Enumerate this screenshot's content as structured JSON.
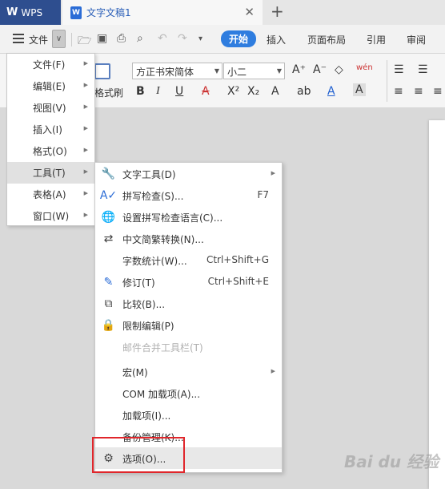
{
  "tabs": {
    "wps_label": "WPS",
    "doc_title": "文字文稿1",
    "close_symbol": "✕",
    "new_tab_symbol": "+"
  },
  "menubar": {
    "file_label": "文件",
    "ribbon_tabs": [
      "开始",
      "插入",
      "页面布局",
      "引用",
      "审阅"
    ],
    "active_tab_index": 0
  },
  "ribbon": {
    "paint_label": "格式刷",
    "font_name": "方正书宋简体",
    "font_size": "小二",
    "buttons_row1": [
      "A⁺",
      "A⁻",
      "◇",
      "wén"
    ],
    "buttons_row2": [
      "B",
      "I",
      "U",
      "A",
      "X²",
      "X₂",
      "A",
      "ab",
      "A",
      "A"
    ]
  },
  "main_menu": {
    "items": [
      {
        "label": "文件(F)"
      },
      {
        "label": "编辑(E)"
      },
      {
        "label": "视图(V)"
      },
      {
        "label": "插入(I)"
      },
      {
        "label": "格式(O)"
      },
      {
        "label": "工具(T)"
      },
      {
        "label": "表格(A)"
      },
      {
        "label": "窗口(W)"
      }
    ],
    "highlighted_index": 5
  },
  "tools_submenu": {
    "items": [
      {
        "label": "文字工具(D)",
        "shortcut": "",
        "icon": "wrench-icon",
        "has_submenu": true,
        "disabled": false
      },
      {
        "label": "拼写检查(S)...",
        "shortcut": "F7",
        "icon": "spellcheck-icon",
        "has_submenu": false,
        "disabled": false
      },
      {
        "label": "设置拼写检查语言(C)...",
        "shortcut": "",
        "icon": "globe-language-icon",
        "has_submenu": false,
        "disabled": false
      },
      {
        "label": "中文简繁转换(N)...",
        "shortcut": "",
        "icon": "convert-icon",
        "has_submenu": false,
        "disabled": false
      },
      {
        "label": "字数统计(W)...",
        "shortcut": "Ctrl+Shift+G",
        "icon": "",
        "has_submenu": false,
        "disabled": false
      },
      {
        "label": "修订(T)",
        "shortcut": "Ctrl+Shift+E",
        "icon": "track-changes-icon",
        "has_submenu": false,
        "disabled": false
      },
      {
        "label": "比较(B)...",
        "shortcut": "",
        "icon": "compare-icon",
        "has_submenu": false,
        "disabled": false
      },
      {
        "label": "限制编辑(P)",
        "shortcut": "",
        "icon": "lock-document-icon",
        "has_submenu": false,
        "disabled": false
      },
      {
        "label": "邮件合并工具栏(T)",
        "shortcut": "",
        "icon": "",
        "has_submenu": false,
        "disabled": true
      },
      {
        "label": "宏(M)",
        "shortcut": "",
        "icon": "",
        "has_submenu": true,
        "disabled": false
      },
      {
        "label": "COM 加载项(A)...",
        "shortcut": "",
        "icon": "",
        "has_submenu": false,
        "disabled": false
      },
      {
        "label": "加载项(I)...",
        "shortcut": "",
        "icon": "",
        "has_submenu": false,
        "disabled": false
      },
      {
        "label": "备份管理(K)...",
        "shortcut": "",
        "icon": "",
        "has_submenu": false,
        "disabled": false
      },
      {
        "label": "选项(O)...",
        "shortcut": "",
        "icon": "gear-icon",
        "has_submenu": false,
        "disabled": false
      }
    ],
    "highlighted_index": 13
  },
  "watermark_text": "Bai du 经验",
  "colors": {
    "accent": "#2f7ddf",
    "wps_tab": "#2e4e8f",
    "highlight_box": "#e0262b"
  }
}
